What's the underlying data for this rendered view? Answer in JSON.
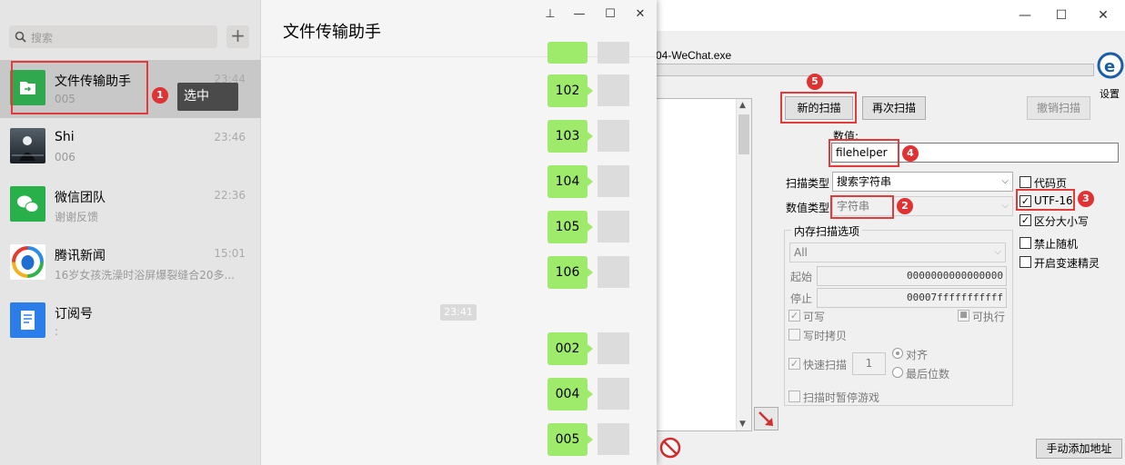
{
  "ce": {
    "window_controls": {
      "minimize": "—",
      "maximize": "☐",
      "close": "✕"
    },
    "process_title": "04-WeChat.exe",
    "settings_label": "设置",
    "buttons": {
      "new_scan": "新的扫描",
      "next_scan": "再次扫描",
      "undo_scan": "撤销扫描",
      "add_address": "手动添加地址"
    },
    "value_label": "数值:",
    "value_input": "filehelper",
    "scan_type_label": "扫描类型",
    "scan_type_value": "搜索字符串",
    "value_type_label": "数值类型",
    "value_type_value": "字符串",
    "mem_options_label": "内存扫描选项",
    "mem_region": "All",
    "start_label": "起始",
    "start_value": "0000000000000000",
    "stop_label": "停止",
    "stop_value": "00007fffffffffff",
    "writable_label": "可写",
    "executable_label": "可执行",
    "cow_label": "写时拷贝",
    "fast_scan_label": "快速扫描",
    "fast_scan_value": "1",
    "align_label": "对齐",
    "last_digits_label": "最后位数",
    "pause_game_label": "扫描时暂停游戏",
    "options": {
      "codepage": "代码页",
      "utf16": "UTF-16",
      "case_sensitive": "区分大小写",
      "no_random": "禁止随机",
      "speedhack": "开启变速精灵"
    },
    "annotations": [
      "1",
      "2",
      "3",
      "4",
      "5"
    ],
    "accent_red": "#e33b3b"
  },
  "wechat": {
    "search_placeholder": "搜索",
    "plus_label": "+",
    "chat_title": "文件传输助手",
    "window_controls": {
      "pin": "⊥",
      "minimize": "—",
      "maximize": "☐",
      "close": "✕"
    },
    "tooltip_select": "选中",
    "conversations": [
      {
        "name": "文件传输助手",
        "preview": "005",
        "time": "23:44"
      },
      {
        "name": "Shi",
        "preview": "006",
        "time": "23:46"
      },
      {
        "name": "微信团队",
        "preview": "谢谢反馈",
        "time": "22:36"
      },
      {
        "name": "腾讯新闻",
        "preview": "16岁女孩洗澡时浴屏爆裂缝合20多...",
        "time": "15:01"
      },
      {
        "name": "订阅号",
        "preview": ":",
        "time": ""
      }
    ],
    "messages_top": [
      "102",
      "103",
      "104",
      "105",
      "106"
    ],
    "timestamp": "23:41",
    "messages_bottom": [
      "002",
      "004",
      "005"
    ],
    "bubble_color": "#9eea6a"
  }
}
